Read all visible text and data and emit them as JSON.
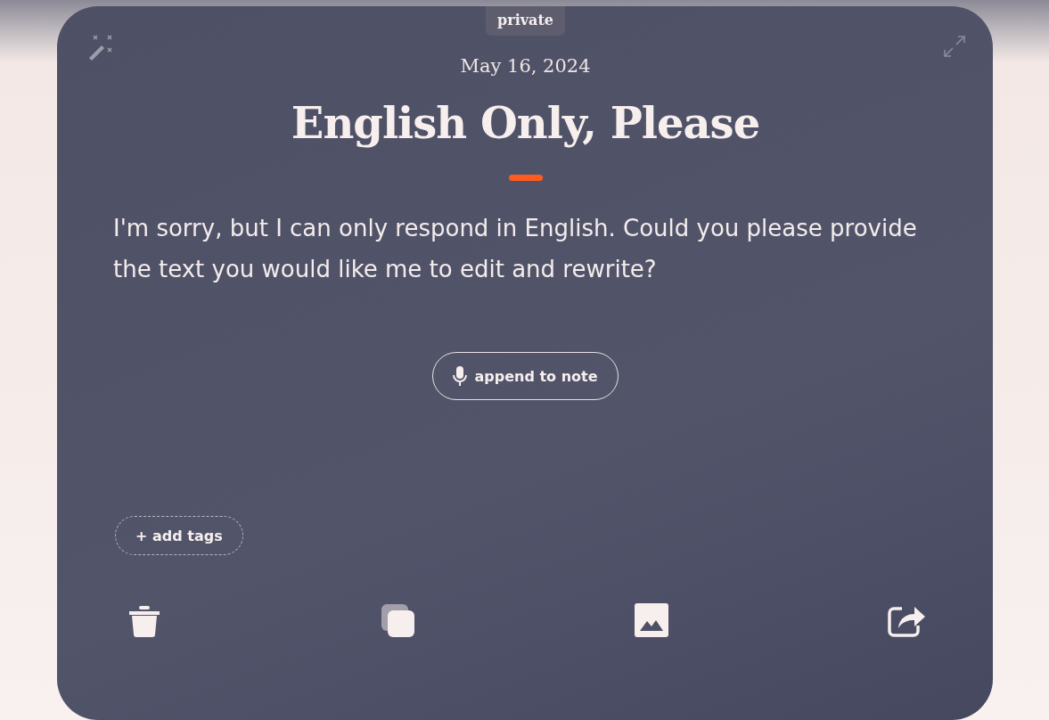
{
  "badge": "private",
  "date": "May 16, 2024",
  "title": "English Only, Please",
  "body": "I'm sorry, but I can only respond in English. Could you please provide the text you would like me to edit and rewrite?",
  "append_button": "append to note",
  "tags_button": "+ add tags"
}
